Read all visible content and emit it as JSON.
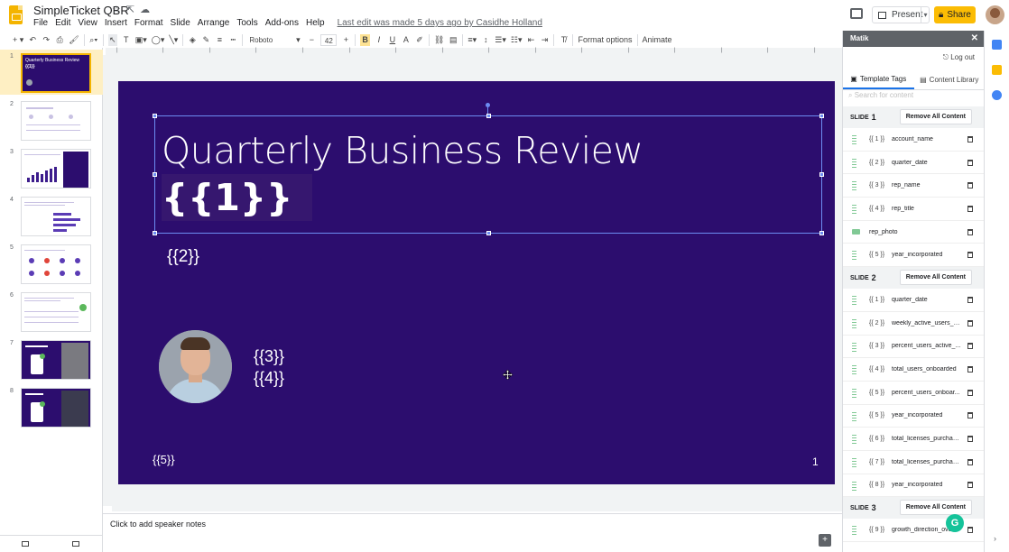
{
  "app": {
    "doc_title": "SimpleTicket QBR",
    "menu": [
      "File",
      "Edit",
      "View",
      "Insert",
      "Format",
      "Slide",
      "Arrange",
      "Tools",
      "Add-ons",
      "Help"
    ],
    "last_edit": "Last edit was made 5 days ago by Casidhe Holland",
    "present_label": "Present",
    "share_label": "Share"
  },
  "toolbar": {
    "font": "Roboto",
    "size": "42",
    "format_options": "Format options",
    "animate": "Animate"
  },
  "filmstrip": {
    "slide_numbers": [
      "1",
      "2",
      "3",
      "4",
      "5",
      "6",
      "7",
      "8"
    ],
    "thumb1_title": "Quarterly Business Review",
    "thumb1_tag": "{{1}}"
  },
  "slide": {
    "title": "Quarterly Business Review",
    "tag1": "{{1}}",
    "tag2": "{{2}}",
    "tag3": "{{3}}",
    "tag4": "{{4}}",
    "tag5": "{{5}}",
    "page_number": "1"
  },
  "notes": {
    "placeholder": "Click to add speaker notes"
  },
  "matik": {
    "title": "Matik",
    "logout": "Log out",
    "tab_template_tags": "Template Tags",
    "tab_content_library": "Content Library",
    "search_placeholder": "Search for content",
    "remove_all_label": "Remove All Content",
    "slide1": {
      "label_prefix": "SLIDE",
      "number": "1",
      "tags": [
        {
          "num": "{{ 1 }}",
          "name": "account_name"
        },
        {
          "num": "{{ 2 }}",
          "name": "quarter_date"
        },
        {
          "num": "{{ 3 }}",
          "name": "rep_name"
        },
        {
          "num": "{{ 4 }}",
          "name": "rep_title"
        },
        {
          "num": "",
          "name": "rep_photo"
        },
        {
          "num": "{{ 5 }}",
          "name": "year_incorporated"
        }
      ]
    },
    "slide2": {
      "label_prefix": "SLIDE",
      "number": "2",
      "tags": [
        {
          "num": "{{ 1 }}",
          "name": "quarter_date"
        },
        {
          "num": "{{ 2 }}",
          "name": "weekly_active_users_a..."
        },
        {
          "num": "{{ 3 }}",
          "name": "percent_users_active_..."
        },
        {
          "num": "{{ 4 }}",
          "name": "total_users_onboarded"
        },
        {
          "num": "{{ 5 }}",
          "name": "percent_users_onboar..."
        },
        {
          "num": "{{ 5 }}",
          "name": "year_incorporated"
        },
        {
          "num": "{{ 6 }}",
          "name": "total_licenses_purchas..."
        },
        {
          "num": "{{ 7 }}",
          "name": "total_licenses_purchas..."
        },
        {
          "num": "{{ 8 }}",
          "name": "year_incorporated"
        }
      ]
    },
    "slide3": {
      "label_prefix": "SLIDE",
      "number": "3",
      "tags": [
        {
          "num": "{{ 9 }}",
          "name": "growth_direction_over..."
        }
      ]
    }
  },
  "colors": {
    "slide_bg": "#2c0d6e",
    "selection": "#6c8cf2",
    "share_yellow": "#fbbc04",
    "matik_header": "#5f6368"
  }
}
